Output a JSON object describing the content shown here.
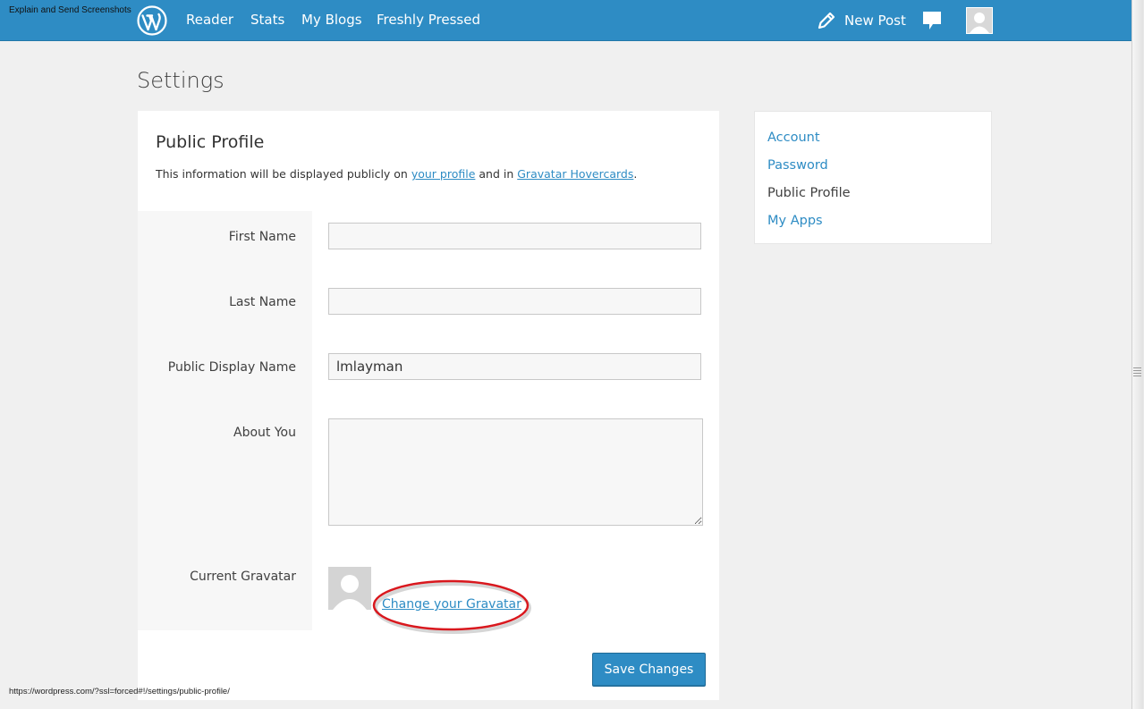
{
  "capture_tool_label": "Explain and Send Screenshots",
  "masterbar": {
    "nav": [
      "Reader",
      "Stats",
      "My Blogs",
      "Freshly Pressed"
    ],
    "new_post": "New Post",
    "icons": [
      "wordpress-logo-icon",
      "pencil-icon",
      "speech-bubble-icon",
      "avatar"
    ]
  },
  "page": {
    "title": "Settings"
  },
  "profile": {
    "heading": "Public Profile",
    "desc_prefix": "This information will be displayed publicly on ",
    "desc_link1": "your profile",
    "desc_middle": " and in ",
    "desc_link2": "Gravatar Hovercards",
    "desc_suffix": ".",
    "fields": {
      "first_name": {
        "label": "First Name",
        "value": ""
      },
      "last_name": {
        "label": "Last Name",
        "value": ""
      },
      "display_name": {
        "label": "Public Display Name",
        "value": "lmlayman"
      },
      "about": {
        "label": "About You",
        "value": ""
      }
    },
    "gravatar_label": "Current Gravatar",
    "change_gravatar": "Change your Gravatar",
    "save_label": "Save Changes"
  },
  "sidebar": {
    "items": [
      {
        "label": "Account",
        "current": false
      },
      {
        "label": "Password",
        "current": false
      },
      {
        "label": "Public Profile",
        "current": true
      },
      {
        "label": "My Apps",
        "current": false
      }
    ]
  },
  "status_bar": {
    "url": "https://wordpress.com/?ssl=forced#!/settings/public-profile/"
  },
  "colors": {
    "accent": "#2e8cc4",
    "background": "#f0f0f0",
    "annotation": "#d9181e"
  }
}
